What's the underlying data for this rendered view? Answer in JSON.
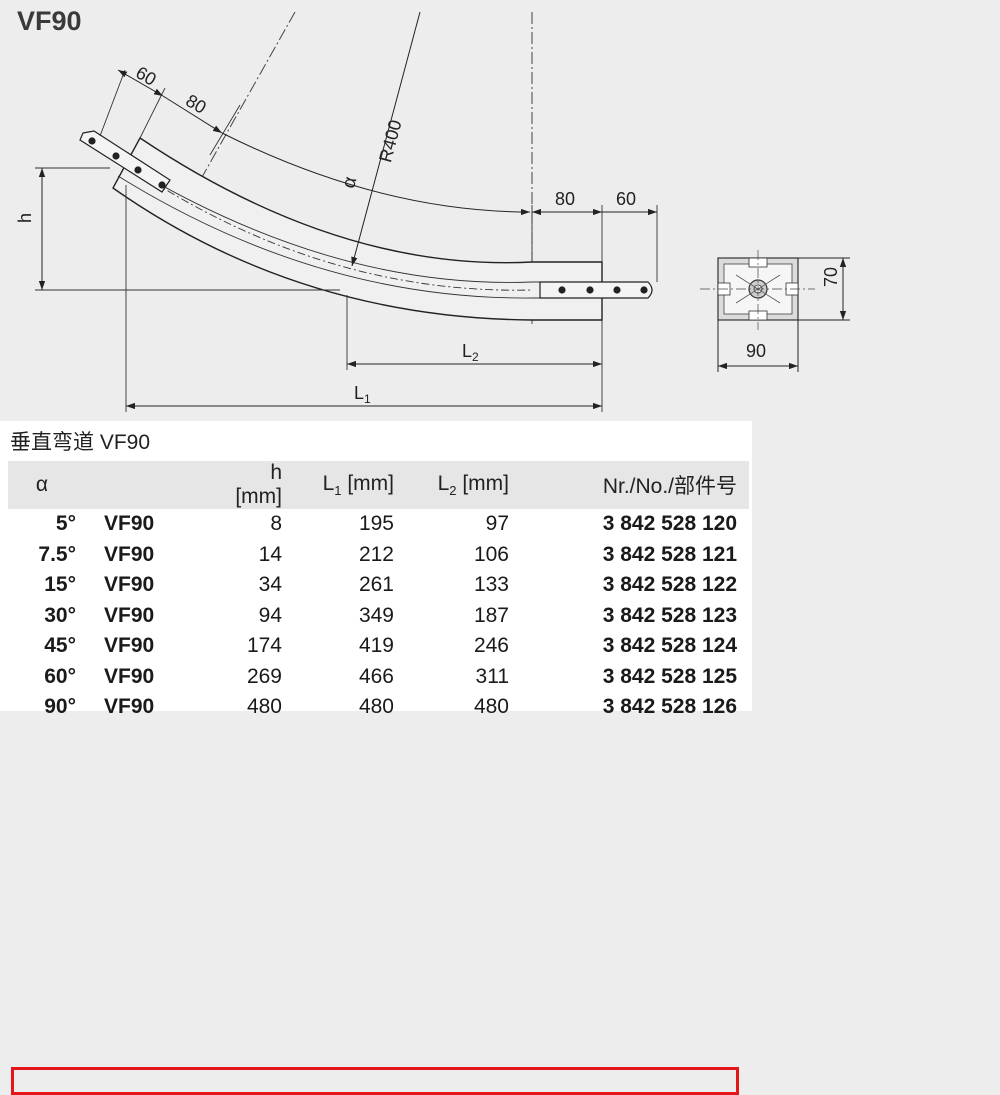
{
  "title": "VF90",
  "drawing": {
    "dim_top_60": "60",
    "dim_top_80": "80",
    "alpha": "α",
    "radius": "R400",
    "dim_right_80": "80",
    "dim_right_60": "60",
    "h_label": "h",
    "l2_label": "L",
    "l2_sub": "2",
    "l1_label": "L",
    "l1_sub": "1",
    "section_height": "70",
    "section_width": "90"
  },
  "table": {
    "caption": "垂直弯道 VF90",
    "headers": {
      "angle": "α",
      "h": "h [mm]",
      "l1_main": "L",
      "l1_sub": "1",
      "l1_unit": " [mm]",
      "l2_main": "L",
      "l2_sub": "2",
      "l2_unit": " [mm]",
      "nr": "Nr./No./部件号"
    },
    "rows": [
      {
        "angle": "5°",
        "type": "VF90",
        "h": "8",
        "l1": "195",
        "l2": "97",
        "nr": "3 842 528 120"
      },
      {
        "angle": "7.5°",
        "type": "VF90",
        "h": "14",
        "l1": "212",
        "l2": "106",
        "nr": "3 842 528 121"
      },
      {
        "angle": "15°",
        "type": "VF90",
        "h": "34",
        "l1": "261",
        "l2": "133",
        "nr": "3 842 528 122"
      },
      {
        "angle": "30°",
        "type": "VF90",
        "h": "94",
        "l1": "349",
        "l2": "187",
        "nr": "3 842 528 123"
      },
      {
        "angle": "45°",
        "type": "VF90",
        "h": "174",
        "l1": "419",
        "l2": "246",
        "nr": "3 842 528 124"
      },
      {
        "angle": "60°",
        "type": "VF90",
        "h": "269",
        "l1": "466",
        "l2": "311",
        "nr": "3 842 528 125"
      },
      {
        "angle": "90°",
        "type": "VF90",
        "h": "480",
        "l1": "480",
        "l2": "480",
        "nr": "3 842 528 126"
      }
    ],
    "highlighted_row": 5,
    "highlight_color": "#e3161b"
  }
}
